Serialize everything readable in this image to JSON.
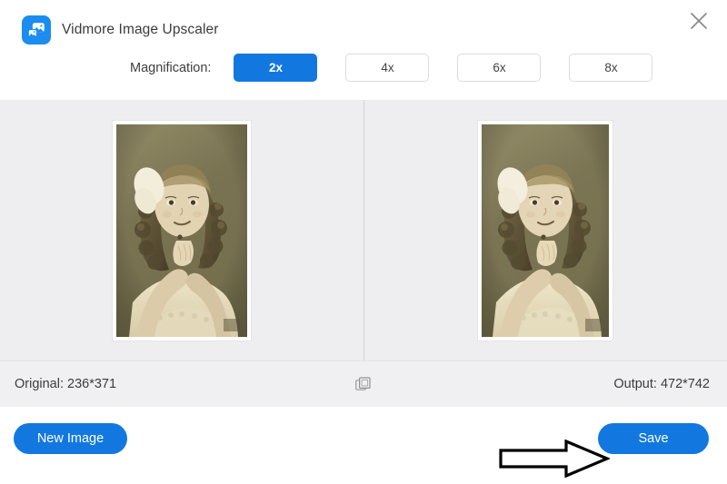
{
  "window": {
    "title": "Vidmore Image Upscaler",
    "logo_icon": "image-stack-icon",
    "close_icon": "close-icon"
  },
  "toolbar": {
    "magnification_label": "Magnification:",
    "options": [
      {
        "label": "2x",
        "active": true
      },
      {
        "label": "4x",
        "active": false
      },
      {
        "label": "6x",
        "active": false
      },
      {
        "label": "8x",
        "active": false
      }
    ]
  },
  "preview": {
    "left_pane_name": "original-preview",
    "right_pane_name": "upscaled-preview",
    "photo_alt": "Sepia vintage portrait photograph of a young girl with curly hair and a large white hair bow, resting her chin on her hands"
  },
  "status": {
    "original_label": "Original: 236*371",
    "output_label": "Output: 472*742",
    "compare_icon": "compare-split-icon"
  },
  "footer": {
    "new_image_label": "New Image",
    "save_label": "Save"
  },
  "annotation": {
    "arrow_name": "pointer-arrow-annotation",
    "points_to": "Save"
  },
  "colors": {
    "accent_blue": "#1278e0",
    "logo_blue": "#1b8cf0",
    "preview_bg": "#eeeef0",
    "status_bg": "#f0f0f2",
    "window_bg": "#ffffff",
    "text": "#3c3c3c",
    "border": "#dcdcdc"
  }
}
